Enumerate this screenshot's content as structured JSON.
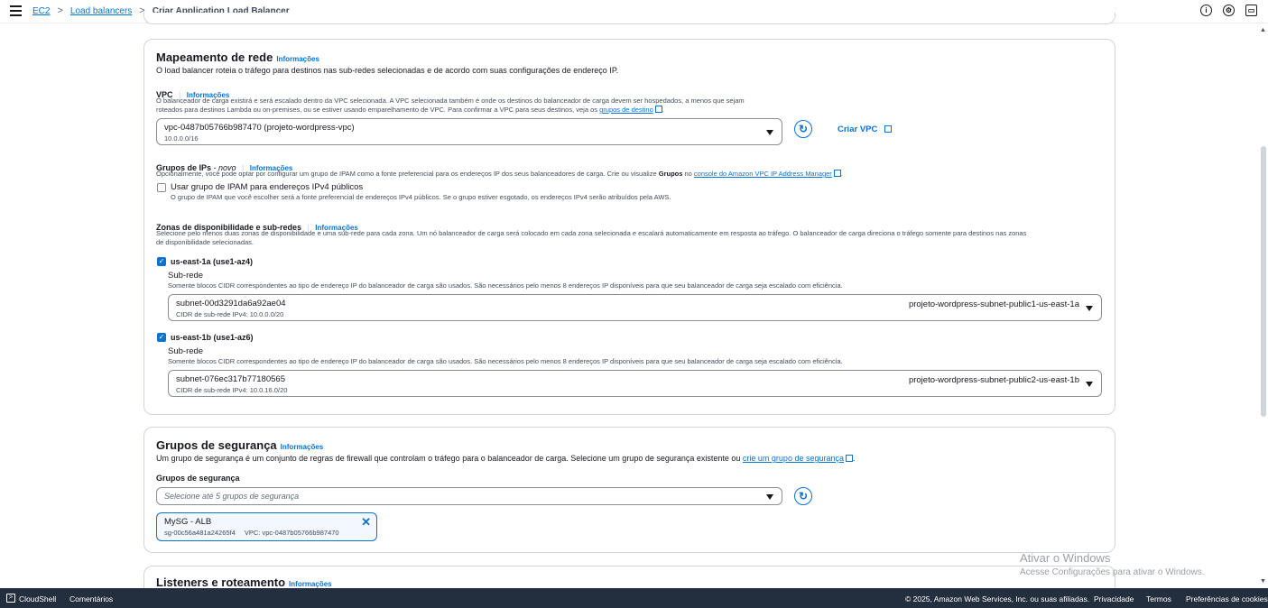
{
  "header": {
    "breadcrumbs": [
      "EC2",
      "Load balancers",
      "Criar Application Load Balancer"
    ],
    "icons": [
      "menu-icon",
      "info-icon",
      "settings-icon",
      "notifications-icon"
    ]
  },
  "network": {
    "title": "Mapeamento de rede",
    "info": "Informações",
    "description": "O load balancer roteia o tráfego para destinos nas sub-redes selecionadas e de acordo com suas configurações de endereço IP.",
    "vpc_label": "VPC",
    "vpc_info": "Informações",
    "vpc_desc1": "O balanceador de carga existirá e será escalado dentro da VPC selecionada. A VPC selecionada também é onde os destinos do balanceador de carga devem ser hospedados, a menos que sejam",
    "vpc_desc2": "roteados para destinos Lambda ou on-premises, ou se estiver usando emparelhamento de VPC. Para confirmar a VPC para seus destinos, veja os",
    "vpc_desc_link": "grupos de destino",
    "vpc_value": "vpc-0487b05766b987470 (projeto-wordpress-vpc)",
    "vpc_cidr": "10.0.0.0/16",
    "create_vpc": "Criar VPC",
    "ipam_label": "Grupos de IPs",
    "ipam_new": " - novo",
    "ipam_info": "Informações",
    "ipam_desc": "Opcionalmente, você pode optar por configurar um grupo de IPAM como a fonte preferencial para os endereços IP dos seus balanceadores de carga. Crie ou visualize",
    "ipam_desc_bold": "Grupos",
    "ipam_desc_no": " no ",
    "ipam_link": "console do Amazon VPC IP Address Manager",
    "ipam_check_label": "Usar grupo de IPAM para endereços IPv4 públicos",
    "ipam_check_desc": "O grupo de IPAM que você escolher será a fonte preferencial de endereços IPv4 públicos. Se o grupo estiver esgotado, os endereços IPv4 serão atribuídos pela AWS.",
    "az_label": "Zonas de disponibilidade e sub-redes",
    "az_info": "Informações",
    "az_desc1": "Selecione pelo menos duas zonas de disponibilidade e uma sub-rede para cada zona. Um nó balanceador de carga será colocado em cada zona selecionada e escalará automaticamente em resposta ao tráfego. O balanceador de carga direciona o tráfego somente para destinos nas zonas",
    "az_desc2": "de disponibilidade selecionadas.",
    "zones": [
      {
        "name": "us-east-1a (use1-az4)",
        "subnet_label": "Sub-rede",
        "subnet_desc": "Somente blocos CIDR correspondentes ao tipo de endereço IP do balanceador de carga são usados. São necessários pelo menos 8 endereços IP disponíveis para que seu balanceador de carga seja escalado com eficiência.",
        "subnet_id": "subnet-00d3291da6a92ae04",
        "subnet_cidr": "CIDR de sub-rede IPv4: 10.0.0.0/20",
        "subnet_name": "projeto-wordpress-subnet-public1-us-east-1a"
      },
      {
        "name": "us-east-1b (use1-az6)",
        "subnet_label": "Sub-rede",
        "subnet_desc": "Somente blocos CIDR correspondentes ao tipo de endereço IP do balanceador de carga são usados. São necessários pelo menos 8 endereços IP disponíveis para que seu balanceador de carga seja escalado com eficiência.",
        "subnet_id": "subnet-076ec317b77180565",
        "subnet_cidr": "CIDR de sub-rede IPv4: 10.0.16.0/20",
        "subnet_name": "projeto-wordpress-subnet-public2-us-east-1b"
      }
    ]
  },
  "security": {
    "title": "Grupos de segurança",
    "info": "Informações",
    "description": "Um grupo de segurança é um conjunto de regras de firewall que controlam o tráfego para o balanceador de carga. Selecione um grupo de segurança existente ou",
    "description_link": "crie um grupo de segurança",
    "field_label": "Grupos de segurança",
    "placeholder": "Selecione até 5 grupos de segurança",
    "token_name": "MySG - ALB",
    "token_id": "sg-00c56a481a24265f4",
    "token_vpc": "VPC: vpc-0487b05766b987470"
  },
  "listeners": {
    "title": "Listeners e roteamento",
    "info": "Informações"
  },
  "watermark": {
    "line1": "Ativar o Windows",
    "line2": "Acesse Configurações para ativar o Windows."
  },
  "footer": {
    "cloudshell": "CloudShell",
    "feedback": "Comentários",
    "copyright": "© 2025, Amazon Web Services, Inc. ou suas afiliadas.",
    "privacy": "Privacidade",
    "terms": "Termos",
    "cookies": "Preferências de cookies"
  }
}
